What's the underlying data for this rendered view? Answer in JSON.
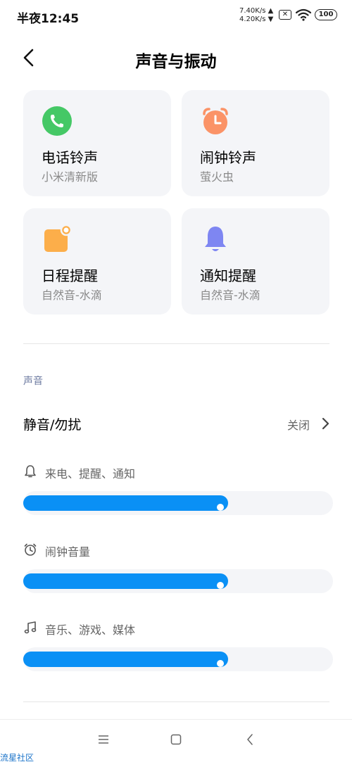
{
  "status": {
    "time": "半夜12:45",
    "speed_up": "7.40K/s ▲",
    "speed_down": "4.20K/s ▼",
    "sim": "✕",
    "battery": "100"
  },
  "header": {
    "title": "声音与振动"
  },
  "cards": [
    {
      "title": "电话铃声",
      "subtitle": "小米清新版",
      "icon": "phone-icon",
      "color": "#45c866"
    },
    {
      "title": "闹钟铃声",
      "subtitle": "萤火虫",
      "icon": "alarm-clock-icon",
      "color": "#fb9367"
    },
    {
      "title": "日程提醒",
      "subtitle": "自然音-水滴",
      "icon": "calendar-icon",
      "color": "#fcae4a"
    },
    {
      "title": "通知提醒",
      "subtitle": "自然音-水滴",
      "icon": "bell-icon",
      "color": "#7e86f2"
    }
  ],
  "sound_section": {
    "label": "声音",
    "mute": {
      "label": "静音/勿扰",
      "value": "关闭"
    },
    "volumes": [
      {
        "label": "来电、提醒、通知",
        "icon": "bell-outline-icon",
        "level_percent": 67
      },
      {
        "label": "闹钟音量",
        "icon": "alarm-outline-icon",
        "level_percent": 67
      },
      {
        "label": "音乐、游戏、媒体",
        "icon": "music-note-icon",
        "level_percent": 67
      }
    ]
  },
  "accent_color": "#0a90f5",
  "watermark": "流星社区"
}
